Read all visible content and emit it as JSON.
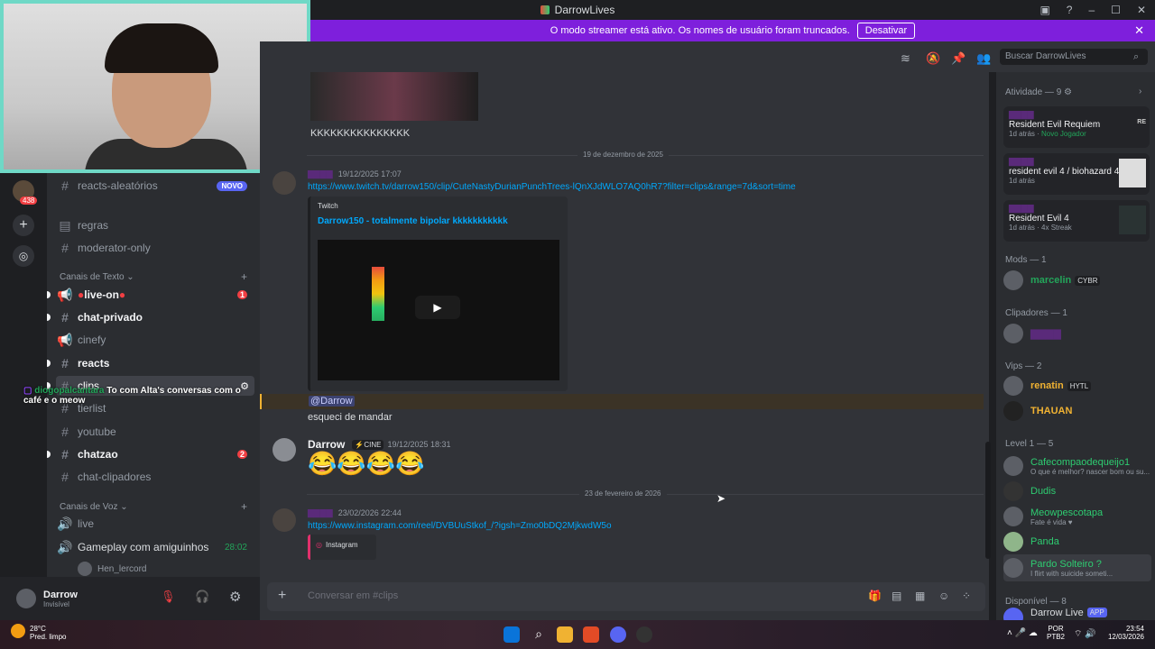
{
  "window": {
    "title": "DarrowLives"
  },
  "banner": {
    "text": "O modo streamer está ativo. Os nomes de usuário foram truncados.",
    "button": "Desativar"
  },
  "servers": {
    "unread_count": "438"
  },
  "channels": {
    "top": [
      {
        "name": "reacts-aleatórios",
        "badge": "NOVO"
      },
      {
        "name": "regras"
      },
      {
        "name": "moderator-only"
      }
    ],
    "text_category": "Canais de Texto",
    "text": [
      {
        "name": "live-on",
        "badge": "1"
      },
      {
        "name": "chat-privado"
      },
      {
        "name": "cinefy"
      },
      {
        "name": "reacts"
      },
      {
        "name": "clips"
      },
      {
        "name": "tierlist"
      },
      {
        "name": "youtube"
      },
      {
        "name": "chatzao",
        "badge": "2"
      },
      {
        "name": "chat-clipadores"
      }
    ],
    "voice_category": "Canais de Voz",
    "voice": [
      {
        "name": "live"
      },
      {
        "name": "Gameplay com amiguinhos",
        "time": "28:02"
      }
    ],
    "voice_user": "Hen_lercord",
    "overlay_chat": {
      "user": "diogopalcantara",
      "text": "To com Alta's conversas com o café e o meow"
    }
  },
  "user_panel": {
    "name": "Darrow",
    "status": "Invisível"
  },
  "chat": {
    "top_text": "KKKKKKKKKKKKKKK",
    "date1": "19 de dezembro de 2025",
    "msg1": {
      "time": "19/12/2025 17:07",
      "link": "https://www.twitch.tv/darrow150/clip/CuteNastyDurianPunchTrees-lQnXJdWLO7AQ0hR7?filter=clips&range=7d&sort=time",
      "embed_provider": "Twitch",
      "embed_title": "Darrow150 - totalmente bipolar kkkkkkkkkkk"
    },
    "mention": "@Darrow",
    "mention_reply": "esqueci de mandar",
    "msg2": {
      "name": "Darrow",
      "tag": "CINE",
      "time": "19/12/2025 18:31",
      "emoji": "😂😂😂😂"
    },
    "date2": "23 de fevereiro de 2026",
    "msg3": {
      "time": "23/02/2026 22:44",
      "link": "https://www.instagram.com/reel/DVBUuStkof_/?igsh=Zmo0bDQ2MjkwdW5o",
      "embed": "Instagram"
    },
    "input_placeholder": "Conversar em #clips"
  },
  "search": {
    "placeholder": "Buscar DarrowLives"
  },
  "members": {
    "activity_header": "Atividade — 9",
    "activities": [
      {
        "game": "Resident Evil Requiem",
        "meta": "1d atrás",
        "extra": "Novo Jogador"
      },
      {
        "game": "resident evil 4 / biohazard 4",
        "meta": "1d atrás",
        "extra": ""
      },
      {
        "game": "Resident Evil 4",
        "meta": "1d atrás",
        "extra": "4x Streak"
      }
    ],
    "mods_header": "Mods — 1",
    "mods": [
      {
        "name": "marcelin",
        "tag": "CYBR"
      }
    ],
    "clip_header": "Clipadores — 1",
    "vips_header": "Vips — 2",
    "vips": [
      {
        "name": "renatin",
        "tag": "HYTL"
      },
      {
        "name": "THAUAN"
      }
    ],
    "level_header": "Level 1 — 5",
    "level": [
      {
        "name": "Cafecompaodequeijo1",
        "status": "O que é melhor? nascer bom ou su..."
      },
      {
        "name": "Dudis",
        "status": ""
      },
      {
        "name": "Meowpescotapa",
        "status": "Fate é vida ♥"
      },
      {
        "name": "Panda",
        "status": ""
      },
      {
        "name": "Pardo Solteiro ?",
        "status": "I flirt with suicide someti..."
      }
    ],
    "avail_header": "Disponível — 8",
    "avail": [
      {
        "name": "Darrow Live",
        "tag": "APP"
      }
    ]
  },
  "taskbar": {
    "weather": "28°C",
    "weather_desc": "Pred. limpo",
    "lang": "POR",
    "layout": "PTB2",
    "time": "23:54",
    "date": "12/03/2026"
  },
  "colors": {
    "banner": "#7e1fdc",
    "accent_link": "#00a8fc",
    "mention": "#f0b232"
  }
}
